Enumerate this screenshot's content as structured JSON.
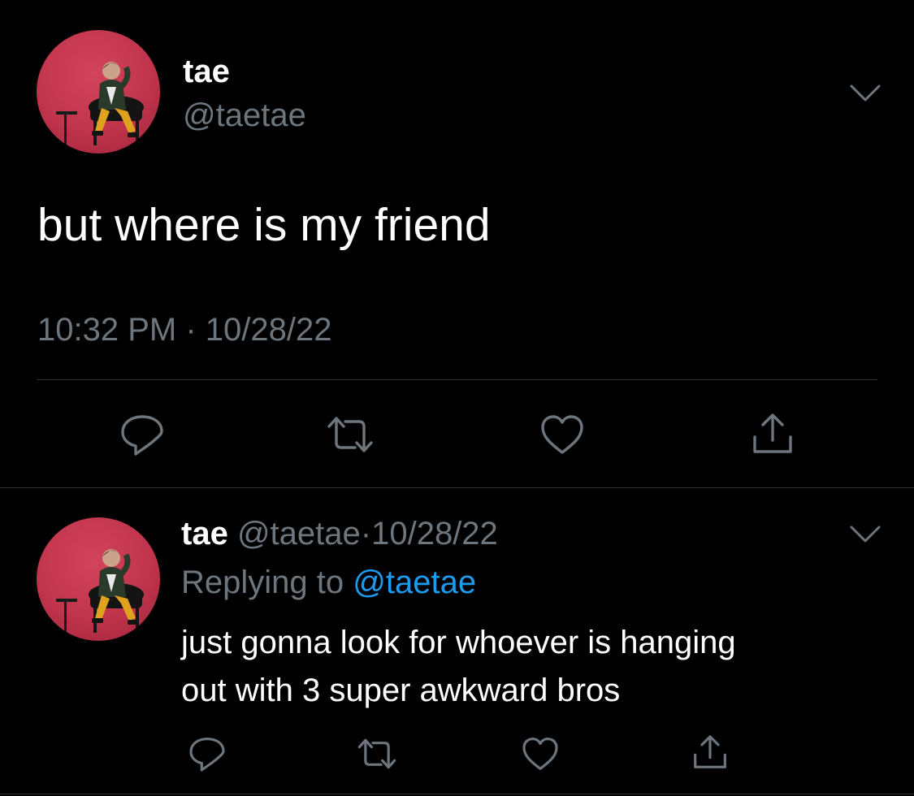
{
  "main_tweet": {
    "display_name": "tae",
    "handle": "@taetae",
    "text": "but where is my friend",
    "timestamp": "10:32 PM · 10/28/22",
    "avatar_icon": "profile-photo",
    "menu_icon": "chevron-down-icon"
  },
  "reply_tweet": {
    "display_name": "tae",
    "handle": "@taetae",
    "separator": "·",
    "date": "10/28/22",
    "replying_to_label": "Replying to",
    "replying_to_handle": "@taetae",
    "text_line1": "just gonna look for whoever is hanging",
    "text_line2": "out with 3 super awkward bros",
    "avatar_icon": "profile-photo",
    "menu_icon": "chevron-down-icon"
  },
  "actions": [
    "reply-icon",
    "retweet-icon",
    "like-icon",
    "share-icon"
  ],
  "colors": {
    "background": "#000000",
    "text": "#ffffff",
    "secondary": "#6e767d",
    "link": "#1d9bf0",
    "divider": "#2f3336",
    "avatar": "#c7384f"
  }
}
